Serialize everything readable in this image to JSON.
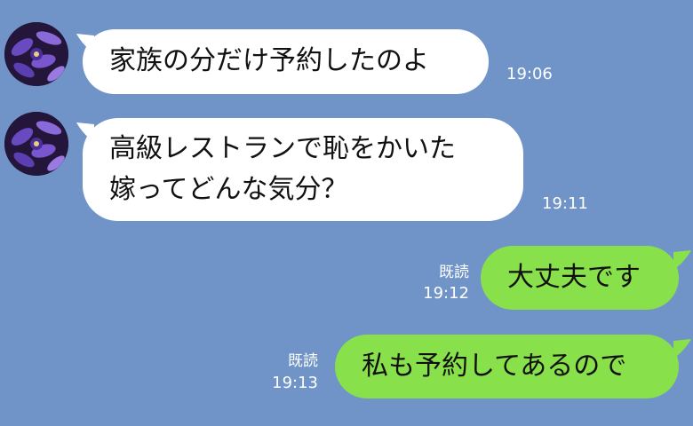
{
  "messages": [
    {
      "sender": "other",
      "lines": [
        "家族の分だけ予約したのよ"
      ],
      "time": "19:06"
    },
    {
      "sender": "other",
      "lines": [
        "高級レストランで恥をかいた",
        "嫁ってどんな気分？"
      ],
      "time": "19:11"
    },
    {
      "sender": "me",
      "lines": [
        "大丈夫です"
      ],
      "read": "既読",
      "time": "19:12"
    },
    {
      "sender": "me",
      "lines": [
        "私も予約してあるので"
      ],
      "read": "既読",
      "time": "19:13"
    }
  ],
  "avatar": {
    "icon": "purple-flower-avatar"
  },
  "colors": {
    "background": "#7094c8",
    "incoming_bubble": "#ffffff",
    "outgoing_bubble": "#88e04a"
  }
}
